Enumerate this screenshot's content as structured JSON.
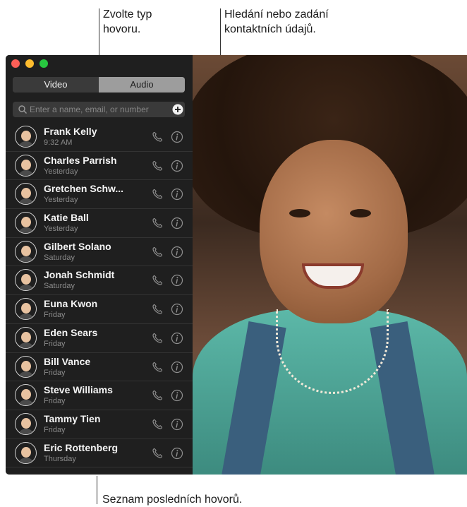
{
  "callouts": {
    "call_type": "Zvolte typ\nhovoru.",
    "search": "Hledání nebo zadání\nkontaktních údajů.",
    "recent_list": "Seznam posledních hovorů."
  },
  "tabs": {
    "video_label": "Video",
    "audio_label": "Audio",
    "selected": "Video"
  },
  "search": {
    "placeholder": "Enter a name, email, or number"
  },
  "calls": [
    {
      "name": "Frank Kelly",
      "time": "9:32 AM"
    },
    {
      "name": "Charles Parrish",
      "time": "Yesterday"
    },
    {
      "name": "Gretchen Schw...",
      "time": "Yesterday"
    },
    {
      "name": "Katie Ball",
      "time": "Yesterday"
    },
    {
      "name": "Gilbert Solano",
      "time": "Saturday"
    },
    {
      "name": "Jonah Schmidt",
      "time": "Saturday"
    },
    {
      "name": "Euna Kwon",
      "time": "Friday"
    },
    {
      "name": "Eden Sears",
      "time": "Friday"
    },
    {
      "name": "Bill Vance",
      "time": "Friday"
    },
    {
      "name": "Steve Williams",
      "time": "Friday"
    },
    {
      "name": "Tammy Tien",
      "time": "Friday"
    },
    {
      "name": "Eric Rottenberg",
      "time": "Thursday"
    }
  ],
  "icons": {
    "search": "search-icon",
    "add": "plus-circle-icon",
    "call": "phone-icon",
    "info": "info-icon"
  },
  "colors": {
    "close": "#fc5f57",
    "minimize": "#fdbc2e",
    "maximize": "#28c840",
    "sidebar": "#1f1f1f"
  }
}
